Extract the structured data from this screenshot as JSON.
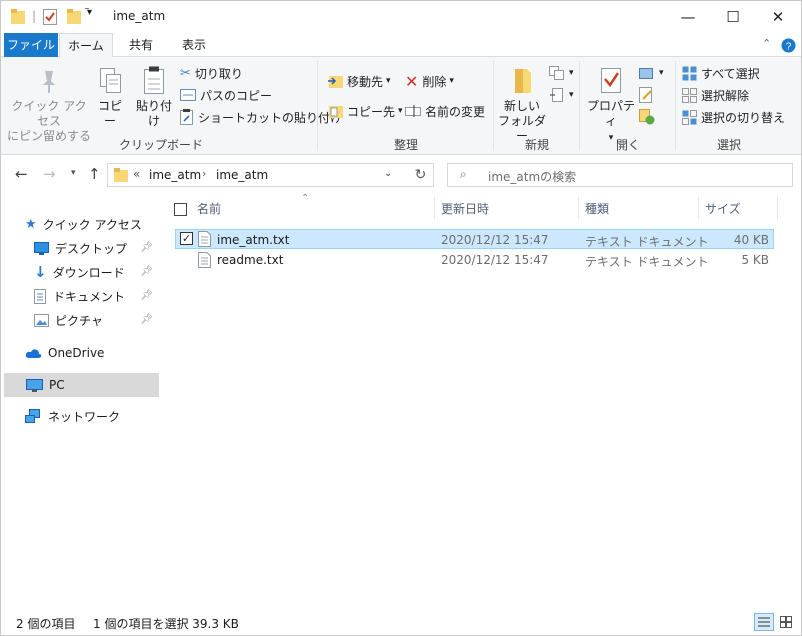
{
  "window": {
    "title": "ime_atm",
    "minimize": "—",
    "maximize": "☐",
    "close": "✕"
  },
  "ribbon_tabs": {
    "file": "ファイル",
    "home": "ホーム",
    "share": "共有",
    "view": "表示"
  },
  "ribbon": {
    "clipboard": {
      "group_label": "クリップボード",
      "pin_line1": "クイック アクセス",
      "pin_line2": "にピン留めする",
      "copy": "コピー",
      "paste": "貼り付け",
      "cut": "切り取り",
      "copy_path": "パスのコピー",
      "paste_shortcut": "ショートカットの貼り付け"
    },
    "organize": {
      "group_label": "整理",
      "move_to": "移動先",
      "copy_to": "コピー先",
      "delete": "削除",
      "rename": "名前の変更"
    },
    "new": {
      "group_label": "新規",
      "new_folder_line1": "新しい",
      "new_folder_line2": "フォルダー"
    },
    "open": {
      "group_label": "開く",
      "properties": "プロパティ"
    },
    "select": {
      "group_label": "選択",
      "select_all": "すべて選択",
      "select_none": "選択解除",
      "invert_selection": "選択の切り替え"
    }
  },
  "address_bar": {
    "overflow": "«",
    "crumbs": [
      "ime_atm",
      "ime_atm"
    ],
    "search_placeholder": "ime_atmの検索"
  },
  "nav_pane": {
    "quick_access": "クイック アクセス",
    "desktop": "デスクトップ",
    "downloads": "ダウンロード",
    "documents": "ドキュメント",
    "pictures": "ピクチャ",
    "onedrive": "OneDrive",
    "pc": "PC",
    "network": "ネットワーク"
  },
  "file_list": {
    "columns": [
      "名前",
      "更新日時",
      "種類",
      "サイズ"
    ],
    "rows": [
      {
        "name": "ime_atm.txt",
        "modified": "2020/12/12 15:47",
        "type": "テキスト ドキュメント",
        "size": "40 KB",
        "selected": true
      },
      {
        "name": "readme.txt",
        "modified": "2020/12/12 15:47",
        "type": "テキスト ドキュメント",
        "size": "5 KB",
        "selected": false
      }
    ]
  },
  "status_bar": {
    "item_count": "2 個の項目",
    "selection": "1 個の項目を選択  39.3 KB"
  },
  "colors": {
    "accent": "#1979ca",
    "selection_bg": "#cce8ff",
    "selection_border": "#99d1ff",
    "nav_selected": "#d9d9d9"
  }
}
